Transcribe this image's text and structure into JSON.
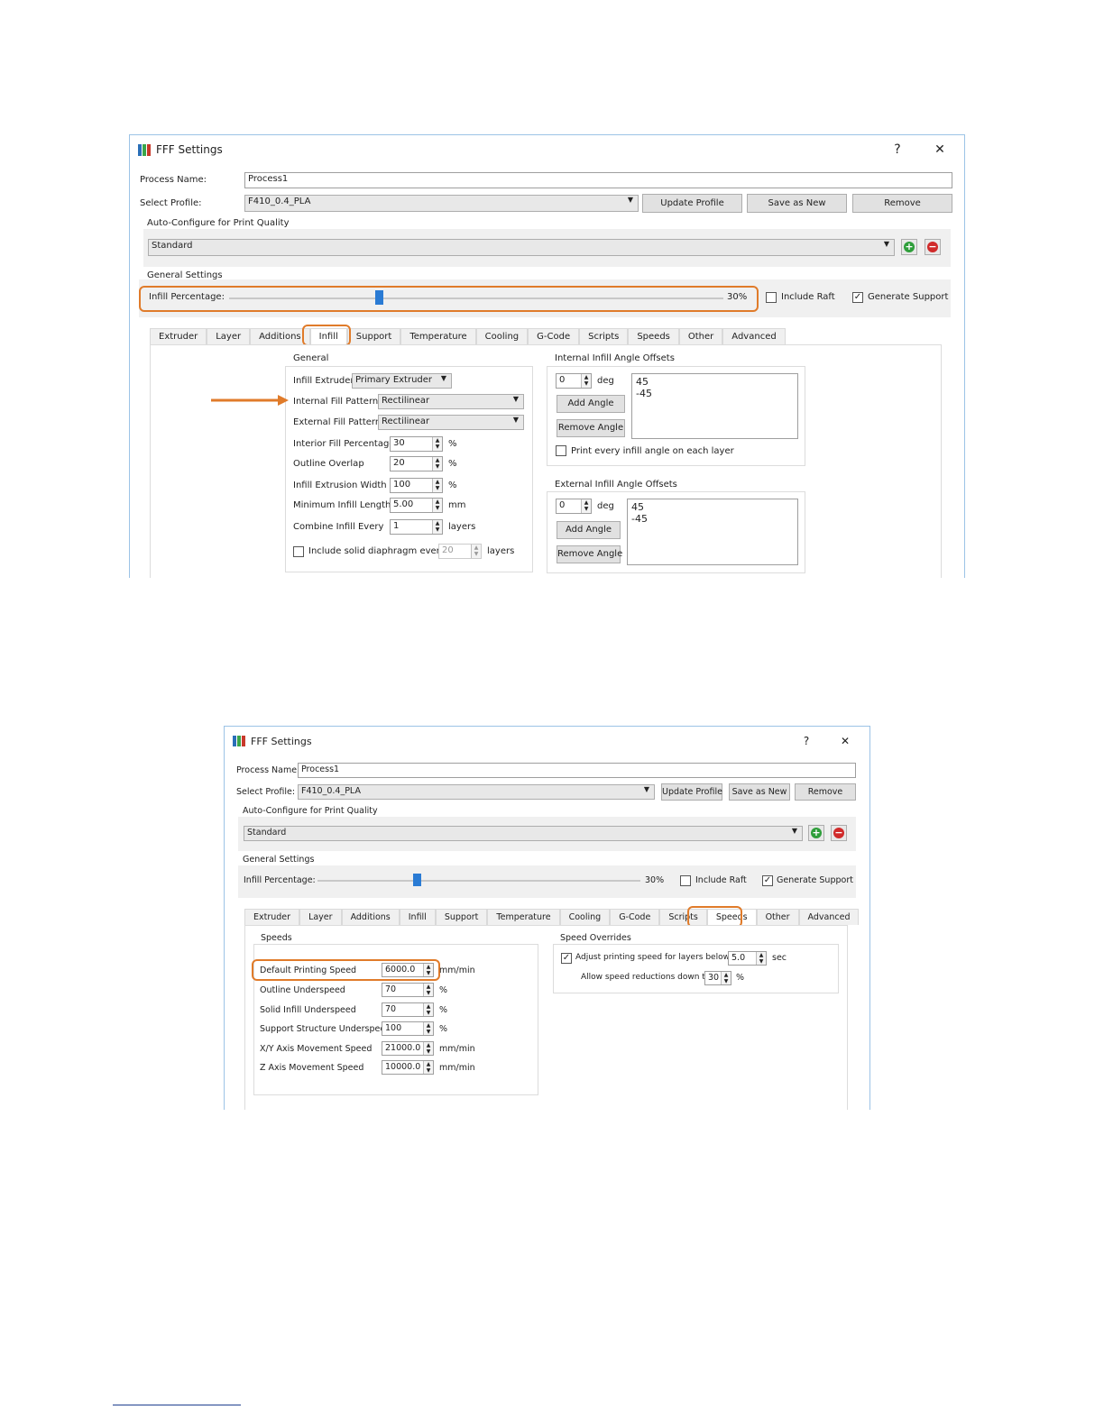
{
  "colors": {
    "highlight": "#e07b2a",
    "slider_thumb": "#2a7bd4",
    "add_green": "#2e9e3a",
    "remove_red": "#d02a2a",
    "window_border": "#9cc3e6"
  },
  "dialog1": {
    "title": "FFF Settings",
    "help": "?",
    "close": "✕",
    "process_name_label": "Process Name:",
    "process_name_value": "Process1",
    "select_profile_label": "Select Profile:",
    "select_profile_value": "F410_0.4_PLA",
    "update_profile": "Update Profile",
    "save_as_new": "Save as New",
    "remove": "Remove",
    "auto_configure_label": "Auto-Configure for Print Quality",
    "quality_value": "Standard",
    "general_settings_label": "General Settings",
    "infill_percentage_label": "Infill Percentage:",
    "infill_percentage_value": "30%",
    "infill_percentage_level": 0.3,
    "include_raft": "Include Raft",
    "include_raft_checked": false,
    "generate_support": "Generate Support",
    "generate_support_checked": true,
    "tabs": [
      "Extruder",
      "Layer",
      "Additions",
      "Infill",
      "Support",
      "Temperature",
      "Cooling",
      "G-Code",
      "Scripts",
      "Speeds",
      "Other",
      "Advanced"
    ],
    "active_tab": "Infill",
    "general_group": {
      "title": "General",
      "infill_extruder_label": "Infill Extruder",
      "infill_extruder_value": "Primary Extruder",
      "internal_fill_pattern_label": "Internal Fill Pattern",
      "internal_fill_pattern_value": "Rectilinear",
      "external_fill_pattern_label": "External Fill Pattern",
      "external_fill_pattern_value": "Rectilinear",
      "rows": [
        {
          "label": "Interior Fill Percentage",
          "value": "30",
          "unit": "%"
        },
        {
          "label": "Outline Overlap",
          "value": "20",
          "unit": "%"
        },
        {
          "label": "Infill Extrusion Width",
          "value": "100",
          "unit": "%"
        },
        {
          "label": "Minimum Infill Length",
          "value": "5.00",
          "unit": "mm"
        },
        {
          "label": "Combine Infill Every",
          "value": "1",
          "unit": "layers"
        }
      ],
      "diaphragm_label": "Include solid diaphragm every",
      "diaphragm_value": "20",
      "diaphragm_unit": "layers"
    },
    "internal_offsets": {
      "title": "Internal Infill Angle Offsets",
      "angle_value": "0",
      "angle_unit": "deg",
      "add_angle": "Add Angle",
      "remove_angle": "Remove Angle",
      "angles": [
        "45",
        "-45"
      ],
      "print_every_label": "Print every infill angle on each layer"
    },
    "external_offsets": {
      "title": "External Infill Angle Offsets",
      "angle_value": "0",
      "angle_unit": "deg",
      "add_angle": "Add Angle",
      "remove_angle": "Remove Angle",
      "angles": [
        "45",
        "-45"
      ]
    }
  },
  "dialog2": {
    "title": "FFF Settings",
    "help": "?",
    "close": "✕",
    "process_name_label": "Process Name:",
    "process_name_value": "Process1",
    "select_profile_label": "Select Profile:",
    "select_profile_value": "F410_0.4_PLA",
    "update_profile": "Update Profile",
    "save_as_new": "Save as New",
    "remove": "Remove",
    "auto_configure_label": "Auto-Configure for Print Quality",
    "quality_value": "Standard",
    "general_settings_label": "General Settings",
    "infill_percentage_label": "Infill Percentage:",
    "infill_percentage_value": "30%",
    "infill_percentage_level": 0.3,
    "include_raft": "Include Raft",
    "include_raft_checked": false,
    "generate_support": "Generate Support",
    "generate_support_checked": true,
    "tabs": [
      "Extruder",
      "Layer",
      "Additions",
      "Infill",
      "Support",
      "Temperature",
      "Cooling",
      "G-Code",
      "Scripts",
      "Speeds",
      "Other",
      "Advanced"
    ],
    "active_tab": "Speeds",
    "speeds_group": {
      "title": "Speeds",
      "rows": [
        {
          "label": "Default Printing Speed",
          "value": "6000.0",
          "unit": "mm/min"
        },
        {
          "label": "Outline Underspeed",
          "value": "70",
          "unit": "%"
        },
        {
          "label": "Solid Infill Underspeed",
          "value": "70",
          "unit": "%"
        },
        {
          "label": "Support Structure Underspeed",
          "value": "100",
          "unit": "%"
        },
        {
          "label": "X/Y Axis Movement Speed",
          "value": "21000.0",
          "unit": "mm/min"
        },
        {
          "label": "Z Axis Movement Speed",
          "value": "10000.0",
          "unit": "mm/min"
        }
      ]
    },
    "overrides_group": {
      "title": "Speed Overrides",
      "adjust_label": "Adjust printing speed for layers below",
      "adjust_checked": true,
      "adjust_value": "5.0",
      "adjust_unit": "sec",
      "allow_label": "Allow speed reductions down to",
      "allow_value": "30",
      "allow_unit": "%"
    }
  }
}
